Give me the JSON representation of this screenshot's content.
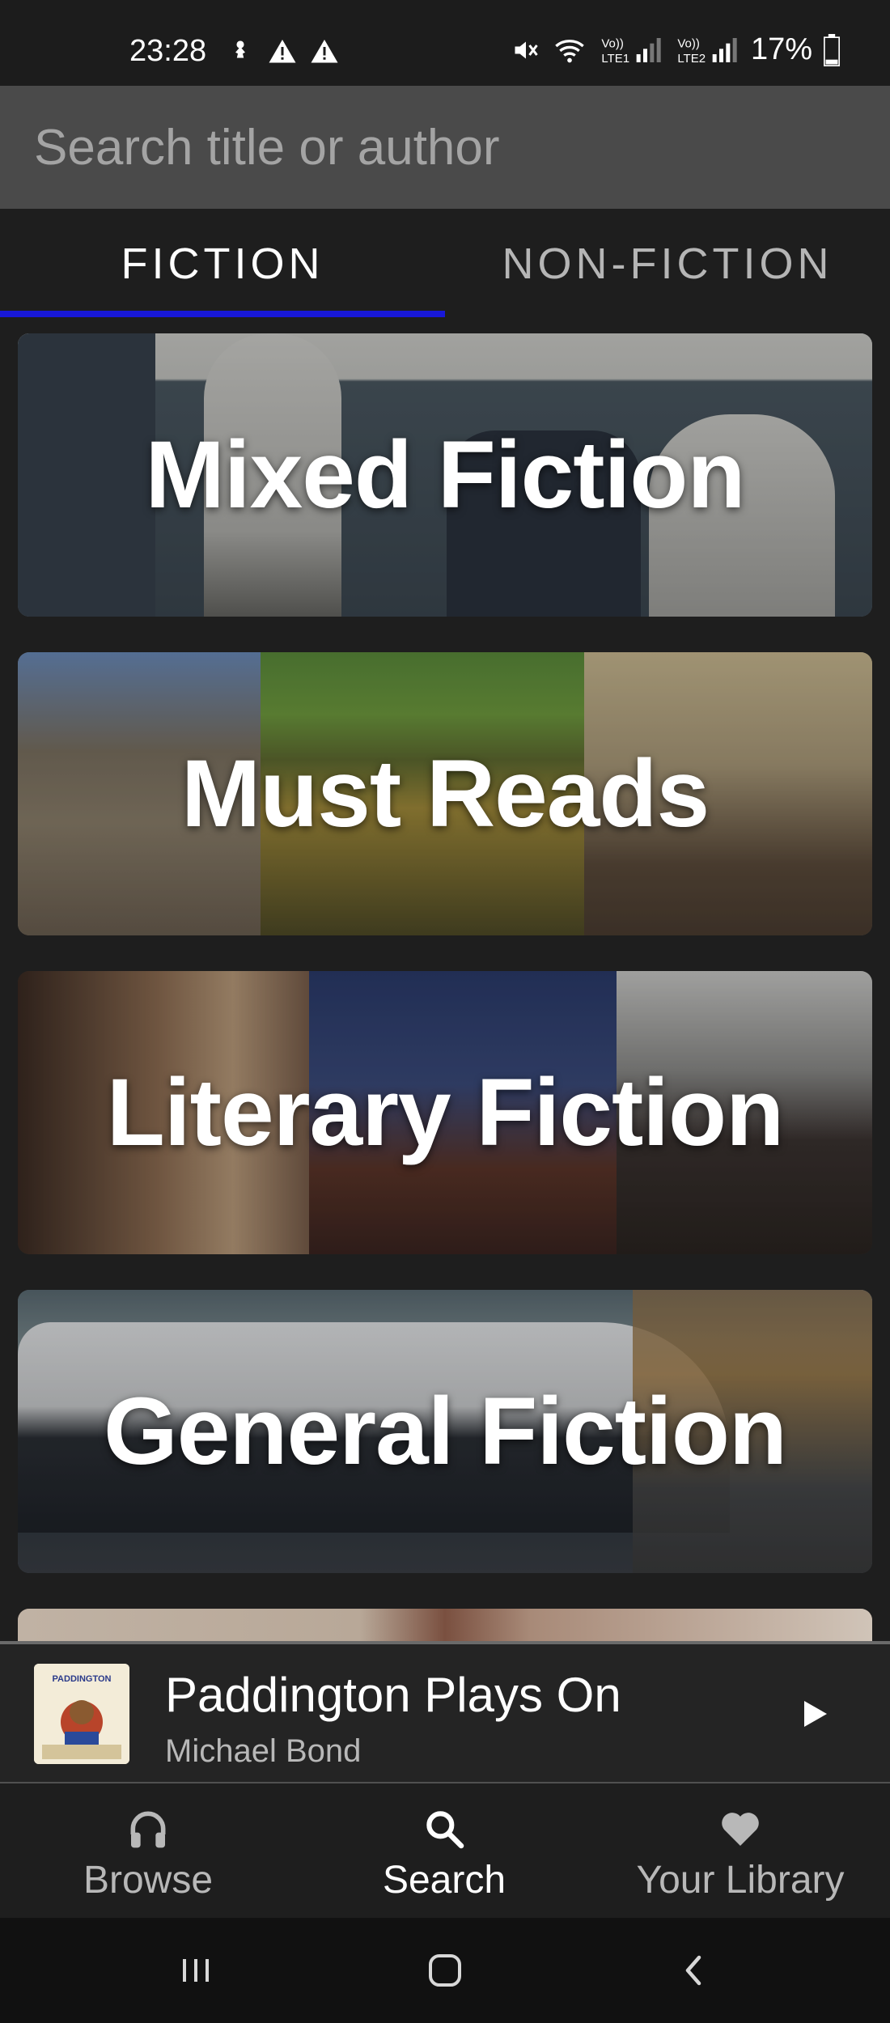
{
  "status_bar": {
    "time": "23:28",
    "battery": "17%",
    "icons": [
      "notification-icon",
      "warning-icon",
      "warning-icon",
      "mute-icon",
      "wifi-icon",
      "lte1-signal-icon",
      "lte2-signal-icon",
      "battery-icon"
    ]
  },
  "search": {
    "placeholder": "Search title or author",
    "value": ""
  },
  "tabs": [
    {
      "label": "FICTION",
      "selected": true
    },
    {
      "label": "NON-FICTION",
      "selected": false
    }
  ],
  "categories": [
    {
      "label": "Mixed Fiction"
    },
    {
      "label": "Must Reads"
    },
    {
      "label": "Literary Fiction"
    },
    {
      "label": "General Fiction"
    },
    {
      "label": ""
    }
  ],
  "now_playing": {
    "title": "Paddington Plays On",
    "author": "Michael Bond",
    "cover_text": "PADDINGTON"
  },
  "bottom_nav": [
    {
      "label": "Browse",
      "icon": "headphones-icon"
    },
    {
      "label": "Search",
      "icon": "search-icon",
      "active": true
    },
    {
      "label": "Your Library",
      "icon": "heart-icon"
    }
  ],
  "system_nav": [
    "recent-apps-icon",
    "home-icon",
    "back-icon"
  ],
  "colors": {
    "tab_indicator": "#1818d8",
    "search_bar": "#4a4a4a",
    "background": "#1e1e1e"
  }
}
